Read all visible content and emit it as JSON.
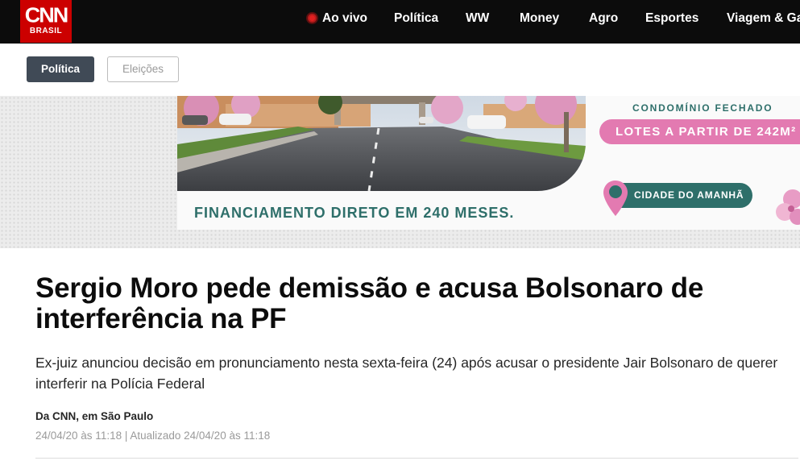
{
  "brand": {
    "logo_text": "CNN",
    "logo_sub": "BRASIL",
    "color": "#cc0000"
  },
  "nav": {
    "live_label": "Ao vivo",
    "items": [
      "Política",
      "WW",
      "Money",
      "Agro",
      "Esportes",
      "Viagem & Ga"
    ]
  },
  "tags": {
    "active": "Política",
    "inactive": "Eleições"
  },
  "ad": {
    "condo_label": "CONDOMÍNIO FECHADO",
    "lots_label": "LOTES A PARTIR DE 242M²",
    "city_label": "CIDADE DO AMANHÃ",
    "financing_label": "FINANCIAMENTO DIRETO EM 240 MESES.",
    "colors": {
      "teal": "#2e6f6a",
      "pink": "#e37ab1"
    }
  },
  "article": {
    "headline": "Sergio Moro pede demissão e acusa Bolsonaro de interferência na PF",
    "subheadline": "Ex-juiz anunciou decisão em pronunciamento nesta sexta-feira (24) após acusar o presidente Jair Bolsonaro de querer interferir na Polícia Federal",
    "byline": "Da CNN, em São Paulo",
    "timestamp": "24/04/20 às 11:18 | Atualizado 24/04/20 às 11:18"
  }
}
